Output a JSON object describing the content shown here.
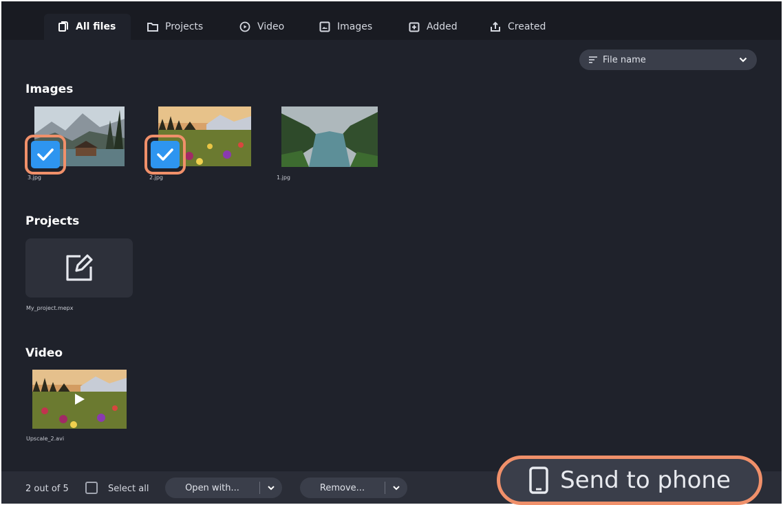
{
  "tabs": [
    {
      "label": "All files",
      "icon": "files-icon",
      "active": true
    },
    {
      "label": "Projects",
      "icon": "folder-icon",
      "active": false
    },
    {
      "label": "Video",
      "icon": "play-circle-icon",
      "active": false
    },
    {
      "label": "Images",
      "icon": "image-icon",
      "active": false
    },
    {
      "label": "Added",
      "icon": "add-box-icon",
      "active": false
    },
    {
      "label": "Created",
      "icon": "share-upload-icon",
      "active": false
    }
  ],
  "sort": {
    "label": "File name",
    "icon": "sort-lines-icon"
  },
  "sections": {
    "images": {
      "title": "Images",
      "items": [
        {
          "name": "3.jpg",
          "checked": true
        },
        {
          "name": "2.jpg",
          "checked": true
        },
        {
          "name": "1.jpg",
          "checked": false
        }
      ]
    },
    "projects": {
      "title": "Projects",
      "items": [
        {
          "name": "My_project.mepx",
          "icon": "edit-icon"
        }
      ]
    },
    "video": {
      "title": "Video",
      "items": [
        {
          "name": "Upscale_2.avi",
          "icon": "play-icon"
        }
      ]
    }
  },
  "bottom": {
    "count": "2 out of 5",
    "select_all": "Select all",
    "open_with": "Open with...",
    "remove": "Remove...",
    "send_to_phone": "Send to phone"
  },
  "colors": {
    "background": "#1f222b",
    "tabbar": "#191b22",
    "accent_highlight": "#f0906a",
    "checkbox_blue": "#2e95f0"
  }
}
